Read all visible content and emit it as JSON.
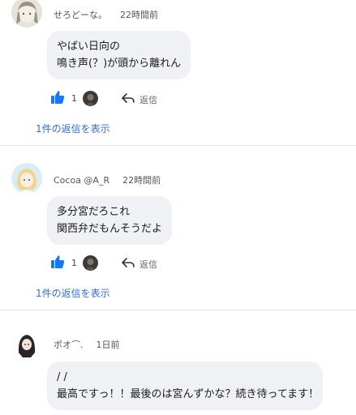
{
  "comments": [
    {
      "username": "せろどーな。",
      "time": "22時間前",
      "lines": [
        "やばい日向の",
        "鳴き声(？)が頭から離れん"
      ],
      "like_count": "1",
      "reply_label": "返信",
      "show_replies": "1件の返信を表示"
    },
    {
      "username": "Cocoa @A_R",
      "time": "22時間前",
      "lines": [
        "多分宮だろこれ",
        "関西弁だもんそうだよ"
      ],
      "like_count": "1",
      "reply_label": "返信",
      "show_replies": "1件の返信を表示"
    },
    {
      "username": "ポオ⌒.",
      "time": "1日前",
      "lines": [
        "/ /",
        "最高ですっ！！最後のは宮んずかな？続き待ってます！"
      ]
    }
  ],
  "colors": {
    "accent": "#2f6ddc",
    "like": "#1877f2",
    "bubble": "#eff1f5",
    "divider": "#e3e3e3"
  },
  "icons": {
    "like": "thumbs-up-icon",
    "reply": "reply-arrow-icon"
  }
}
